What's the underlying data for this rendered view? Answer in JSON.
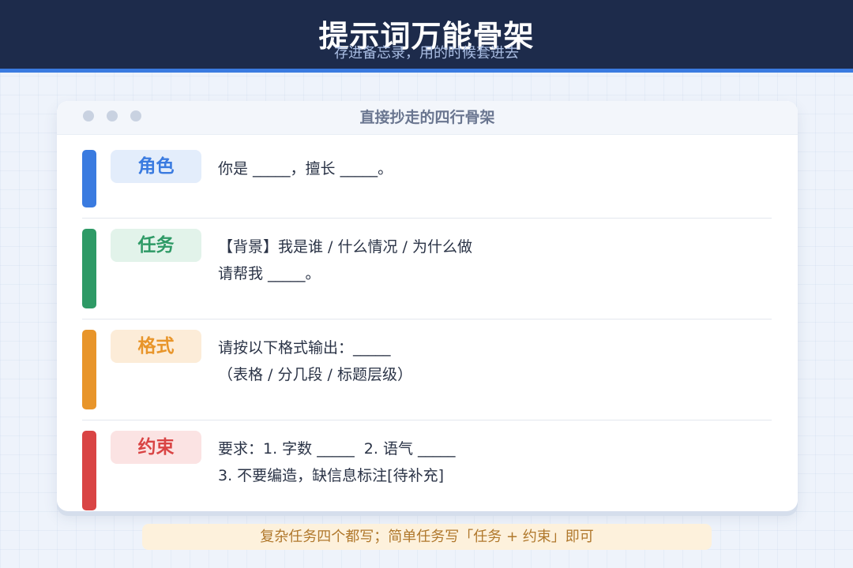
{
  "header": {
    "title": "提示词万能骨架",
    "subtitle": "存进备忘录，用的时候套进去"
  },
  "card": {
    "title": "直接抄走的四行骨架",
    "rows": [
      {
        "label": "角色",
        "color": "#3a7be0",
        "tag_bg": "#e3edfb",
        "lines": [
          "你是 _____，擅长 _____。"
        ]
      },
      {
        "label": "任务",
        "color": "#2e9a66",
        "tag_bg": "#e2f3ea",
        "lines": [
          "【背景】我是谁 / 什么情况 / 为什么做",
          "请帮我 _____。"
        ]
      },
      {
        "label": "格式",
        "color": "#e8952a",
        "tag_bg": "#fcecd8",
        "lines": [
          "请按以下格式输出：_____",
          "（表格 / 分几段 / 标题层级）"
        ]
      },
      {
        "label": "约束",
        "color": "#d94444",
        "tag_bg": "#fbe3e3",
        "lines": [
          "要求：1. 字数 _____  2. 语气 _____",
          "3. 不要编造，缺信息标注[待补充]"
        ]
      }
    ]
  },
  "footer": {
    "note": "复杂任务四个都写；简单任务写「任务 + 约束」即可"
  }
}
